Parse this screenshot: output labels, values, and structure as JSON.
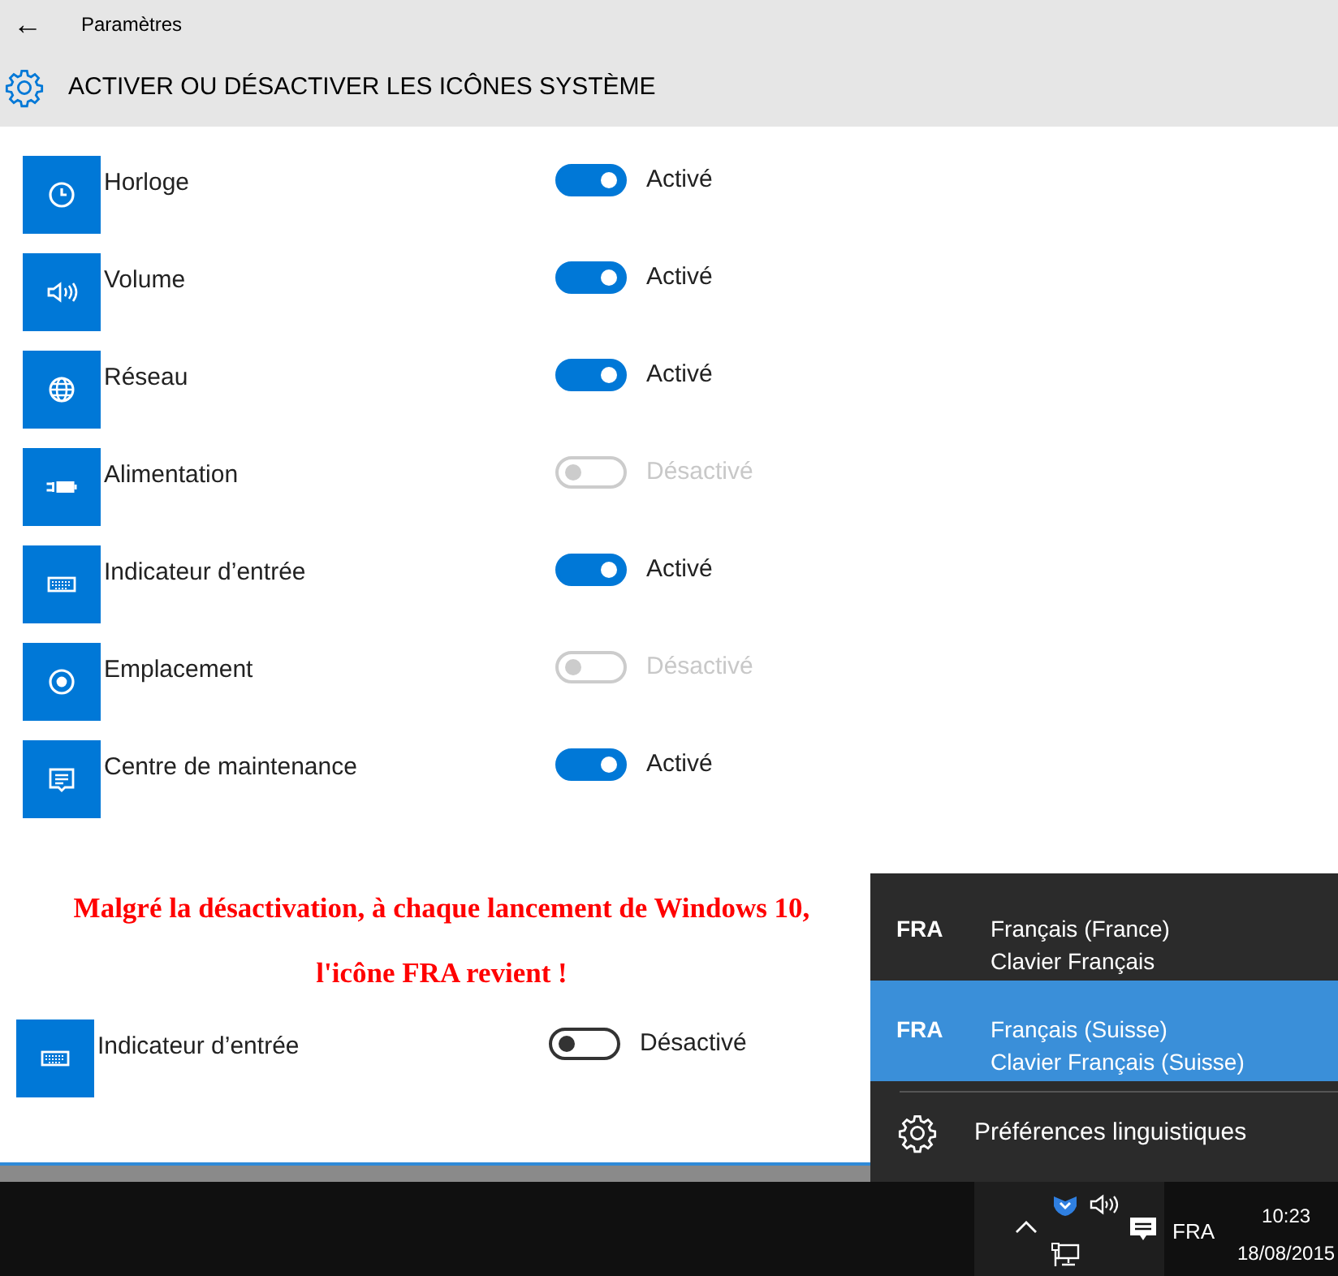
{
  "window": {
    "back": "←",
    "title": "Paramètres"
  },
  "page": {
    "heading": "ACTIVER OU DÉSACTIVER LES ICÔNES SYSTÈME"
  },
  "icons": [
    {
      "kind": "clock",
      "label": "Horloge",
      "on": true,
      "disabled": false,
      "state": "Activé"
    },
    {
      "kind": "volume",
      "label": "Volume",
      "on": true,
      "disabled": false,
      "state": "Activé"
    },
    {
      "kind": "globe",
      "label": "Réseau",
      "on": true,
      "disabled": false,
      "state": "Activé"
    },
    {
      "kind": "battery",
      "label": "Alimentation",
      "on": false,
      "disabled": true,
      "state": "Désactivé"
    },
    {
      "kind": "keyboard",
      "label": "Indicateur d’entrée",
      "on": true,
      "disabled": false,
      "state": "Activé"
    },
    {
      "kind": "location",
      "label": "Emplacement",
      "on": false,
      "disabled": true,
      "state": "Désactivé"
    },
    {
      "kind": "message",
      "label": "Centre de maintenance",
      "on": true,
      "disabled": false,
      "state": "Activé"
    }
  ],
  "annotation": {
    "lines": [
      "Malgré la désactivation, à chaque lancement de Windows 10,",
      "l'icône FRA revient !"
    ]
  },
  "extra_row": {
    "kind": "keyboard",
    "label": "Indicateur d’entrée",
    "on": false,
    "disabled": false,
    "state": "Désactivé"
  },
  "language_flyout": {
    "items": [
      {
        "code": "FRA",
        "language": "Français (France)",
        "keyboard": "Clavier Français",
        "selected": false
      },
      {
        "code": "FRA",
        "language": "Français (Suisse)",
        "keyboard": "Clavier Français (Suisse)",
        "selected": true
      }
    ],
    "footer": "Préférences linguistiques"
  },
  "taskbar": {
    "language": "FRA",
    "time": "10:23",
    "date": "18/08/2015"
  }
}
